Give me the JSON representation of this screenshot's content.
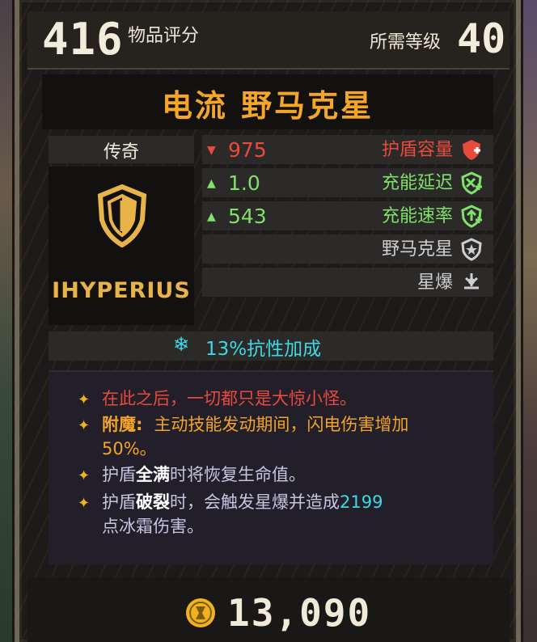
{
  "header": {
    "item_score": "416",
    "item_score_label": "物品评分",
    "required_level_label": "所需等级",
    "required_level": "40"
  },
  "item": {
    "name": "电流 野马克星",
    "rarity": "传奇",
    "manufacturer": "IHYPERIUS",
    "stats": [
      {
        "value": "975",
        "trend": "down",
        "label": "护盾容量",
        "icon": "shield-capacity-icon",
        "color": "#e84a3c"
      },
      {
        "value": "1.0",
        "trend": "up",
        "label": "充能延迟",
        "icon": "recharge-delay-icon",
        "color": "#7fe06a"
      },
      {
        "value": "543",
        "trend": "up",
        "label": "充能速率",
        "icon": "recharge-rate-icon",
        "color": "#7fe06a"
      },
      {
        "value": "",
        "trend": "",
        "label": "野马克星",
        "icon": "shield-perk-icon",
        "color": "#cfcfcf"
      },
      {
        "value": "",
        "trend": "",
        "label": "星爆",
        "icon": "nova-icon",
        "color": "#cfcfcf"
      }
    ],
    "resistance": "13%抗性加成",
    "resistance_icon": "snowflake-icon",
    "description": {
      "flavor": "在此之后，一切都只是大惊小怪。",
      "anoint_label": "附魔:",
      "anoint_text_1": "主动技能发动期间，闪电伤害增加",
      "anoint_text_2": "50%。",
      "line3_a": "护盾",
      "line3_b": "全满",
      "line3_c": "时将恢复生命值。",
      "line4_a": "护盾",
      "line4_b": "破裂",
      "line4_c": "时，会触发星爆并造成",
      "line4_d": "2199",
      "line4_e": "点冰霜伤害。"
    },
    "price": "13,090",
    "price_icon": "eridium-coin-icon"
  },
  "colors": {
    "title": "#f5a628",
    "flavor": "#e84a3c",
    "anoint": "#f2a329",
    "damage": "#3fd8e4",
    "text": "#c8c4e0"
  }
}
